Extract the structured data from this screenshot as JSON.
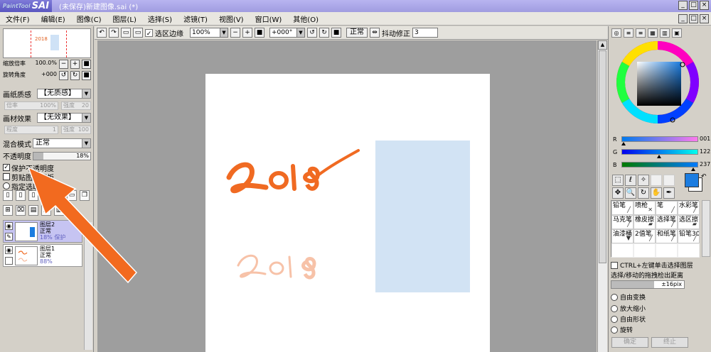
{
  "app": {
    "logo_small": "PaintTool",
    "logo_big": "SAI",
    "window_title": "(未保存)新建图像.sai (*)"
  },
  "menu": [
    "文件(F)",
    "编辑(E)",
    "图像(C)",
    "图层(L)",
    "选择(S)",
    "滤镜(T)",
    "视图(V)",
    "窗口(W)",
    "其他(O)"
  ],
  "navigator": {
    "zoom_label": "缩放倍率",
    "zoom_value": "100.0%",
    "angle_label": "旋转角度",
    "angle_value": "+000",
    "thumb_text": "2018"
  },
  "paper": {
    "texture_label": "画纸质感",
    "texture_value": "【无质感】",
    "scale_label": "倍率",
    "scale_value": "100%",
    "intensity_label": "强度",
    "intensity_value": "20",
    "effect_label": "画材效果",
    "effect_value": "【无效果】",
    "degree_label": "程度",
    "degree_value": "1",
    "strength_label": "强度",
    "strength_value": "100"
  },
  "blend": {
    "mode_label": "混合模式",
    "mode_value": "正常",
    "opacity_label": "不透明度",
    "opacity_value": "18%",
    "opacity_fraction": 0.18
  },
  "checks": {
    "protect_opacity": "保护不透明度",
    "clip_group": "剪贴图层蒙板",
    "select_source": "指定选取来源"
  },
  "layers": [
    {
      "name": "图层2",
      "mode": "正常",
      "opacity": "18%",
      "extra": "保护"
    },
    {
      "name": "图层1",
      "mode": "正常",
      "opacity": "88%"
    }
  ],
  "canvas_toolbar": {
    "selection_edge": "选区边缘",
    "zoom": "100%",
    "rotation": "+000°",
    "mode": "正常",
    "stabilizer_label": "抖动修正",
    "stabilizer_value": "3"
  },
  "canvas": {
    "text_main": "2018",
    "text_faded": "2018"
  },
  "color": {
    "r_label": "R",
    "r_value": "001",
    "g_label": "G",
    "g_value": "122",
    "b_label": "B",
    "b_value": "237",
    "main_swatch": "#1b7ce0"
  },
  "brushes": [
    {
      "name": "铅笔"
    },
    {
      "name": "喷枪"
    },
    {
      "name": "笔"
    },
    {
      "name": "水彩笔"
    },
    {
      "name": "马克笔"
    },
    {
      "name": "橡皮擦"
    },
    {
      "name": "选择笔"
    },
    {
      "name": "选区擦"
    },
    {
      "name": "油漆桶"
    },
    {
      "name": "2值笔"
    },
    {
      "name": "和纸笔"
    },
    {
      "name": "铅笔30"
    }
  ],
  "transform": {
    "ctrl_select": "CTRL+左键单击选择图层",
    "drag_distance_label": "选择/移动的拖拽检出距离",
    "drag_distance_value": "±16pix",
    "free_transform": "自由变换",
    "scale": "放大缩小",
    "free_shape": "自由形状",
    "rotate": "旋转",
    "ok": "确定",
    "stop": "终止"
  },
  "colors": {
    "accent": "#f06a22",
    "title_bar": "#a8a4e8",
    "selected_layer": "#c6c4f2"
  }
}
